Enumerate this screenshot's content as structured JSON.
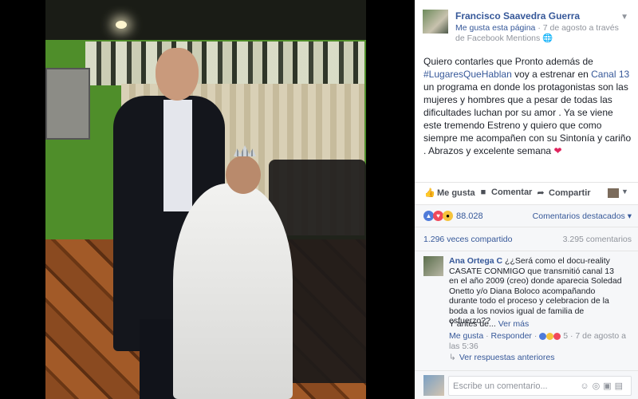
{
  "post": {
    "author": "Francisco Saavedra Guerra",
    "meta_like_page": "Me gusta esta página",
    "meta_date": " · 7 de agosto a través de ",
    "meta_via": "Facebook Mentions",
    "meta_globe": "🌐",
    "text_before": "Quiero contarles que Pronto además de ",
    "hashtag": "#LugaresQueHablan",
    "text_mid": " voy a estrenar en ",
    "channel": "Canal 13",
    "text_after": " un programa en donde los protagonistas son las mujeres y hombres que a pesar de todas las dificultades luchan por su amor . Ya se viene este tremendo Estreno y quiero que como siempre me acompañen con su Sintonía y cariño . Abrazos y excelente semana ",
    "heart": "❤"
  },
  "actions": {
    "like": "Me gusta",
    "comment": "Comentar",
    "share": "Compartir",
    "like_icon": "👍",
    "comment_icon": "■",
    "share_icon": "➦",
    "caret": "▼"
  },
  "stats": {
    "reactions_count": "88.028",
    "featured_comments": "Comentarios destacados ▾",
    "shares": "1.296 veces compartido",
    "comments": "3.295 comentarios"
  },
  "comment": {
    "author": "Ana Ortega C",
    "text": " ¿¿Será como el docu-reality CASATE CONMIGO que transmitió canal 13 en el año 2009 (creo) donde aparecia Soledad Onetto y/o Diana Boloco acompañando durante todo el proceso y celebracion de la boda a los novios igual de familia de esfuerzo??",
    "more_prefix": "Y antes de... ",
    "more_link": "Ver más",
    "like": "Me gusta",
    "reply": "Responder",
    "reaction_count": "5",
    "date": " · 7 de agosto a las 5:36",
    "view_replies": "Ver respuestas anteriores"
  },
  "composer": {
    "placeholder": "Escribe un comentario...",
    "icons": "☺◎▣▤"
  }
}
